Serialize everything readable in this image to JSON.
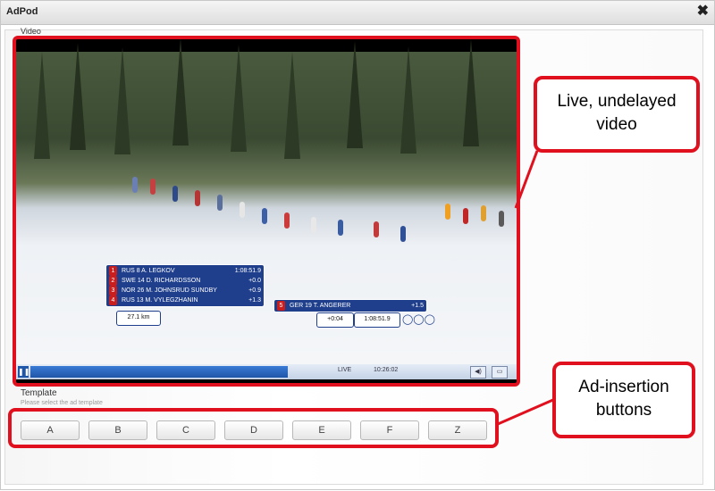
{
  "window": {
    "title": "AdPod",
    "close_icon": "close-icon"
  },
  "sections": {
    "video_label": "Video",
    "template_label": "Template",
    "template_hint": "Please select the ad template"
  },
  "overlay": {
    "leaders": [
      {
        "rank": "1",
        "country": "RUS",
        "bib": "8",
        "name": "A. LEGKOV",
        "time": "1:08:51.9"
      },
      {
        "rank": "2",
        "country": "SWE",
        "bib": "14",
        "name": "D. RICHARDSSON",
        "time": "+0.0"
      },
      {
        "rank": "3",
        "country": "NOR",
        "bib": "26",
        "name": "M. JOHNSRUD SUNDBY",
        "time": "+0.9"
      },
      {
        "rank": "4",
        "country": "RUS",
        "bib": "13",
        "name": "M. VYLEGZHANIN",
        "time": "+1.3"
      }
    ],
    "distance": "27.1 km",
    "focus": {
      "rank": "5",
      "country": "GER",
      "bib": "19",
      "name": "T. ANGERER",
      "gap": "+1.5"
    },
    "focus_split": "+0:04",
    "focus_time": "1:08:51.9"
  },
  "player": {
    "live_label": "LIVE",
    "clock": "10:26:02"
  },
  "callouts": {
    "video": [
      "Live, undelayed",
      "video"
    ],
    "ad": [
      "Ad-insertion",
      "buttons"
    ]
  },
  "ad_buttons": [
    "A",
    "B",
    "C",
    "D",
    "E",
    "F",
    "Z"
  ]
}
